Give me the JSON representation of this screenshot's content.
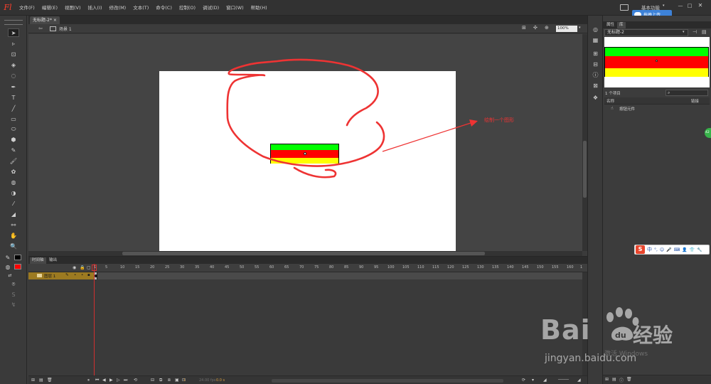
{
  "app": {
    "logo": "Fl"
  },
  "menu": [
    "文件(F)",
    "编辑(E)",
    "视图(V)",
    "插入(I)",
    "修改(M)",
    "文本(T)",
    "命令(C)",
    "控制(O)",
    "调试(D)",
    "窗口(W)",
    "帮助(H)"
  ],
  "workspace": {
    "label": "基本功能",
    "dropdown": "▾"
  },
  "window_controls": {
    "minimize": "—",
    "maximize": "□",
    "close": "✕"
  },
  "upload_button": {
    "label": "拖拽上传"
  },
  "document": {
    "tab_label": "无标题-2*",
    "close": "×"
  },
  "edit_bar": {
    "back": "⇦",
    "scene_label": "场景 1",
    "zoom": "100%",
    "zoom_dropdown": "▾"
  },
  "stage": {
    "annotation_text": "绘制一个图形",
    "shape_colors": {
      "top": "#00ff00",
      "middle": "#ff0000",
      "bottom": "#ffff00"
    },
    "annotation_color": "#ee3333"
  },
  "timeline": {
    "tabs": [
      "时间轴",
      "输出"
    ],
    "ruler": [
      "1",
      "5",
      "10",
      "15",
      "20",
      "25",
      "30",
      "35",
      "40",
      "45",
      "50",
      "55",
      "60",
      "65",
      "70",
      "75",
      "80",
      "85",
      "90",
      "95",
      "100",
      "105",
      "110",
      "115",
      "120",
      "125",
      "130",
      "135",
      "140",
      "145",
      "150",
      "155",
      "160",
      "1"
    ],
    "layer": {
      "name": "图层 1"
    },
    "footer": {
      "fps": "24.00 fps",
      "time": "0.0 s",
      "frame": "1"
    }
  },
  "right_panel": {
    "tabs": [
      "属性",
      "库"
    ],
    "library_doc": "无标题-2",
    "item_count": "1 个项目",
    "columns": {
      "name": "名称",
      "linkage": "链接"
    },
    "items": [
      {
        "name": "按钮元件"
      }
    ]
  },
  "side_badge": "42",
  "ime": {
    "logo": "S",
    "mode": "中",
    "icons": [
      "°,",
      "☺",
      "🎤",
      "⌨",
      "👤",
      "👕",
      "🔧"
    ]
  },
  "watermark": {
    "bai": "Bai",
    "paw": "du",
    "jingyan": "经验",
    "url": "jingyan.baidu.com",
    "activate": "激活 Windows"
  },
  "tool_icons": [
    "select-icon",
    "subselect-icon",
    "free-transform-icon",
    "3d-rotation-icon",
    "lasso-icon",
    "pen-icon",
    "text-icon",
    "line-icon",
    "rectangle-icon",
    "oval-icon",
    "polystar-icon",
    "pencil-icon",
    "brush-icon",
    "deco-icon",
    "bone-icon",
    "paint-bucket-icon",
    "eyedropper-icon",
    "eraser-icon",
    "camera-icon",
    "hand-icon",
    "zoom-icon"
  ]
}
